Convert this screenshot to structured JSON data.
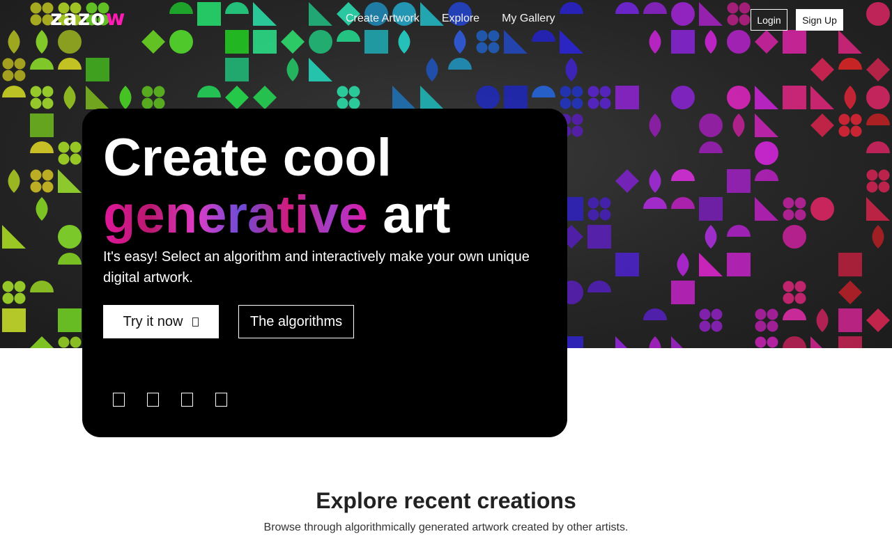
{
  "nav": {
    "logo_main": "zazo",
    "logo_accent": "w",
    "links": [
      "Create Artwork",
      "Explore",
      "My Gallery"
    ],
    "login_label": "Login",
    "signup_label": "Sign Up"
  },
  "hero": {
    "headline_line1": "Create cool",
    "headline_gradient": "generative",
    "headline_end": " art",
    "subtitle": "It's easy! Select an algorithm and interactively make your own unique digital artwork.",
    "try_label": "Try it now",
    "algorithms_label": "The algorithms",
    "social_icons": [
      "social-icon-1",
      "social-icon-2",
      "social-icon-3",
      "social-icon-4"
    ]
  },
  "section": {
    "title": "Explore recent creations",
    "subtitle": "Browse through algorithmically generated artwork created by other artists."
  },
  "colors": {
    "accent": "#ff1ab3",
    "hero_bg": "#262626",
    "card_bg": "#000000"
  }
}
